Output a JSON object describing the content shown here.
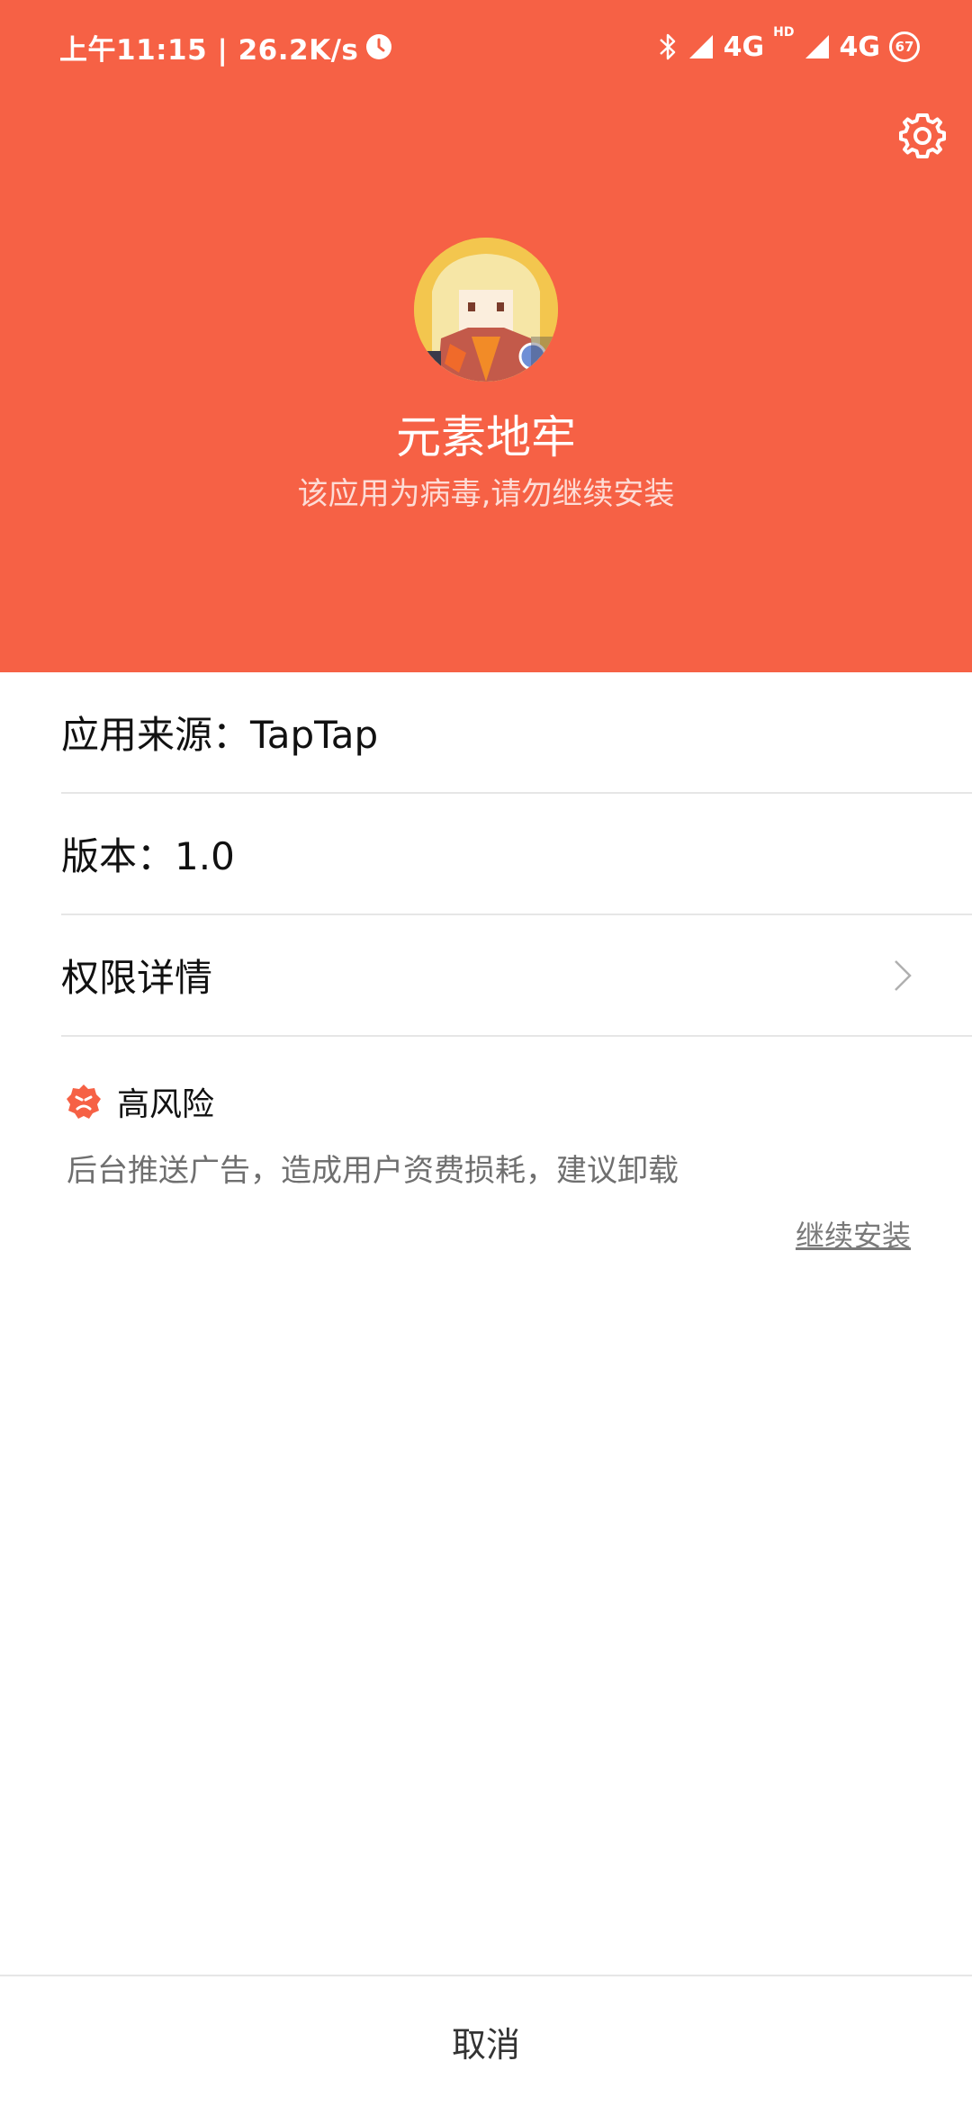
{
  "status_bar": {
    "time_speed": "上午11:15 | 26.2K/s",
    "network_1": "4G",
    "hd_label": "HD",
    "network_2": "4G",
    "battery": "67"
  },
  "header": {
    "app_name": "元素地牢",
    "warning": "该应用为病毒,请勿继续安装",
    "accent_color": "#f66145"
  },
  "details": {
    "source": "应用来源：TapTap",
    "version": "版本：1.0",
    "permissions": "权限详情"
  },
  "risk": {
    "level": "高风险",
    "description": "后台推送广告，造成用户资费损耗，建议卸载",
    "continue_label": "继续安装"
  },
  "footer": {
    "cancel_label": "取消"
  },
  "icons": [
    "clock-icon",
    "bluetooth-icon",
    "signal-icon",
    "battery-icon",
    "gear-icon",
    "app-icon",
    "chevron-right-icon",
    "danger-icon"
  ]
}
